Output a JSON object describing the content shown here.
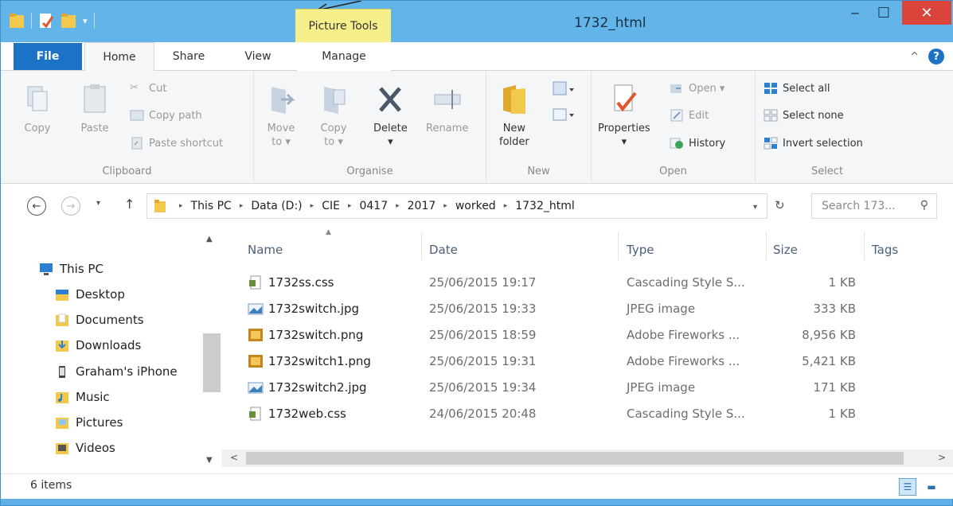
{
  "window": {
    "title": "1732_html",
    "contextual_tab_group": "Picture Tools"
  },
  "tabs": {
    "file": "File",
    "home": "Home",
    "share": "Share",
    "view": "View",
    "manage": "Manage"
  },
  "ribbon": {
    "clipboard": {
      "label": "Clipboard",
      "copy": "Copy",
      "paste": "Paste",
      "cut": "Cut",
      "copy_path": "Copy path",
      "paste_shortcut": "Paste shortcut"
    },
    "organise": {
      "label": "Organise",
      "move_to_1": "Move",
      "move_to_2": "to ▾",
      "copy_to_1": "Copy",
      "copy_to_2": "to ▾",
      "delete": "Delete",
      "rename": "Rename"
    },
    "new": {
      "label": "New",
      "new_folder_1": "New",
      "new_folder_2": "folder"
    },
    "open": {
      "label": "Open",
      "properties": "Properties",
      "open": "Open ▾",
      "edit": "Edit",
      "history": "History"
    },
    "select": {
      "label": "Select",
      "select_all": "Select all",
      "select_none": "Select none",
      "invert_selection": "Invert selection"
    }
  },
  "address": {
    "breadcrumbs": [
      "This PC",
      "Data (D:)",
      "CIE",
      "0417",
      "2017",
      "worked",
      "1732_html"
    ],
    "search_placeholder": "Search 173..."
  },
  "nav_pane": {
    "items": [
      {
        "label": "This PC",
        "icon": "computer-icon"
      },
      {
        "label": "Desktop",
        "icon": "desktop-folder-icon"
      },
      {
        "label": "Documents",
        "icon": "documents-folder-icon"
      },
      {
        "label": "Downloads",
        "icon": "downloads-folder-icon"
      },
      {
        "label": "Graham's iPhone",
        "icon": "phone-icon"
      },
      {
        "label": "Music",
        "icon": "music-folder-icon"
      },
      {
        "label": "Pictures",
        "icon": "pictures-folder-icon"
      },
      {
        "label": "Videos",
        "icon": "videos-folder-icon"
      }
    ]
  },
  "file_list": {
    "columns": {
      "name": "Name",
      "date": "Date",
      "type": "Type",
      "size": "Size",
      "tags": "Tags"
    },
    "rows": [
      {
        "name": "1732ss.css",
        "date": "25/06/2015 19:17",
        "type": "Cascading Style S...",
        "size": "1 KB",
        "icon": "css-file-icon"
      },
      {
        "name": "1732switch.jpg",
        "date": "25/06/2015 19:33",
        "type": "JPEG image",
        "size": "333 KB",
        "icon": "jpeg-file-icon"
      },
      {
        "name": "1732switch.png",
        "date": "25/06/2015 18:59",
        "type": "Adobe Fireworks ...",
        "size": "8,956 KB",
        "icon": "fireworks-file-icon"
      },
      {
        "name": "1732switch1.png",
        "date": "25/06/2015 19:31",
        "type": "Adobe Fireworks ...",
        "size": "5,421 KB",
        "icon": "fireworks-file-icon"
      },
      {
        "name": "1732switch2.jpg",
        "date": "25/06/2015 19:34",
        "type": "JPEG image",
        "size": "171 KB",
        "icon": "jpeg-file-icon"
      },
      {
        "name": "1732web.css",
        "date": "24/06/2015 20:48",
        "type": "Cascading Style S...",
        "size": "1 KB",
        "icon": "css-file-icon"
      }
    ]
  },
  "status": {
    "item_count": "6 items"
  },
  "colors": {
    "title_bar": "#63b4e8",
    "file_tab": "#1c73c6",
    "picture_tools": "#f7f08a",
    "close_button": "#d9443b"
  }
}
